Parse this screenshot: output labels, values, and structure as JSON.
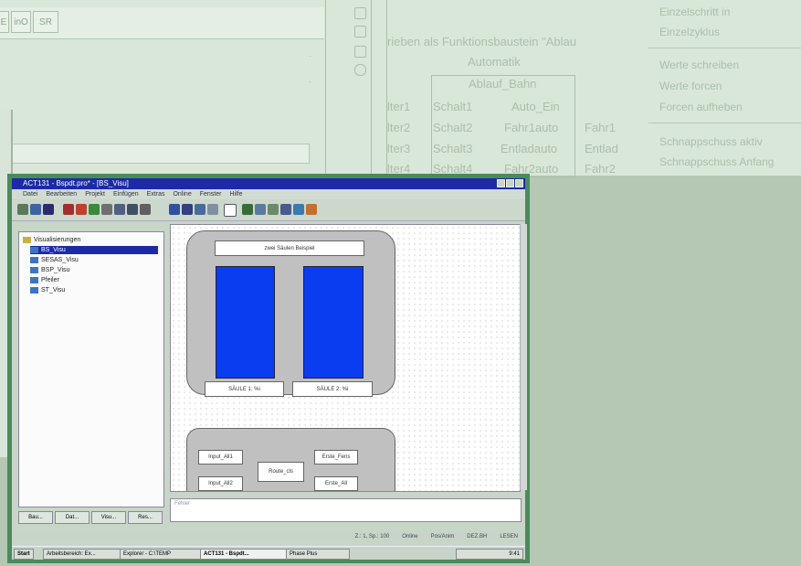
{
  "background_window": {
    "toolbar_buttons": [
      "E",
      "inO",
      "SR"
    ],
    "fb_text": "rieben als Funktionsbaustein \"Ablau",
    "fb_mode": "Automatik",
    "fb_name": "Ablauf_Bahn",
    "fb_rows": [
      {
        "outer": "lter1",
        "in": "Schalt1",
        "out": "Auto_Ein",
        "target": ""
      },
      {
        "outer": "lter2",
        "in": "Schalt2",
        "out": "Fahr1auto",
        "target": "Fahr1"
      },
      {
        "outer": "lter3",
        "in": "Schalt3",
        "out": "Entladauto",
        "target": "Entlad"
      },
      {
        "outer": "lter4",
        "in": "Schalt4",
        "out": "Fahr2auto",
        "target": "Fahr2"
      }
    ],
    "context_menu": [
      "Einzelschritt in",
      "Einzelzyklus",
      "Werte schreiben",
      "Werte forcen",
      "Forcen aufheben",
      "Schnappschuss aktiv",
      "Schnappschuss Anfang"
    ]
  },
  "window": {
    "title": "ACT131 - Bspdt.pro* - [BS_Visu]",
    "menu": [
      "Datei",
      "Bearbeiten",
      "Projekt",
      "Einfügen",
      "Extras",
      "Online",
      "Fenster",
      "Hilfe"
    ],
    "tree": {
      "root": "Visualisierungen",
      "items": [
        "BS_Visu",
        "SESAS_Visu",
        "BSP_Visu",
        "Pfeiler",
        "ST_Visu"
      ],
      "selected_index": 0
    },
    "tree_tabs": [
      "Bau...",
      "Dat...",
      "Visu...",
      "Res..."
    ],
    "canvas": {
      "title_label": "zwei Säulen Beispiel",
      "column_labels": [
        "SÄULE 1: %i",
        "SÄULE 2: %i"
      ],
      "inputs": [
        "Input_All1",
        "Input_All2"
      ],
      "middle": "Route_cls",
      "outputs": [
        "Erste_Fens",
        "Erste_All"
      ],
      "column_fill_color": "#0a3cf0"
    },
    "output_text": "Fehler",
    "status": [
      "Z.: 1, Sp.: 100",
      "Online",
      "Pos/Anim",
      "DEZ.BH",
      "LESEN"
    ],
    "taskbar": [
      "Start",
      "Arbeitsbereich: Ex...",
      "Explorer - C:\\TEMP",
      "ACT131 - Bspdt...",
      "Phase Plus"
    ],
    "taskbar_time": "9:41"
  }
}
